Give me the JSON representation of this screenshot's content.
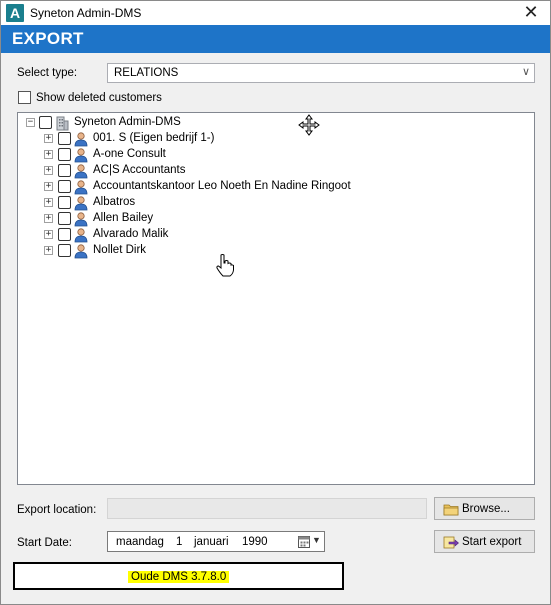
{
  "window": {
    "title": "Syneton Admin-DMS",
    "app_icon_letter": "A",
    "close_glyph": "✕"
  },
  "header": {
    "title": "EXPORT",
    "color": "#1e74c8"
  },
  "select_type": {
    "label": "Select type:",
    "value": "RELATIONS",
    "arrow": "∨"
  },
  "show_deleted": {
    "label": "Show deleted customers",
    "checked": false
  },
  "tree": {
    "root": {
      "label": "Syneton Admin-DMS",
      "expander": "−"
    },
    "items": [
      {
        "label": "001. S (Eigen bedrijf 1-)"
      },
      {
        "label": "A-one Consult"
      },
      {
        "label": "AC|S Accountants"
      },
      {
        "label": "Accountantskantoor Leo Noeth En Nadine Ringoot"
      },
      {
        "label": "Albatros"
      },
      {
        "label": "Allen Bailey"
      },
      {
        "label": "Alvarado Malik"
      },
      {
        "label": "Nollet Dirk"
      }
    ],
    "expander": "+"
  },
  "export_location": {
    "label": "Export location:",
    "value": ""
  },
  "browse_button": {
    "label": "Browse..."
  },
  "start_date": {
    "label": "Start Date:",
    "weekday": "maandag",
    "day": "1",
    "month": "januari",
    "year": "1990"
  },
  "start_export_button": {
    "label": "Start export"
  },
  "version": {
    "text": "Oude DMS 3.7.8.0",
    "highlight": "#ffff00"
  }
}
